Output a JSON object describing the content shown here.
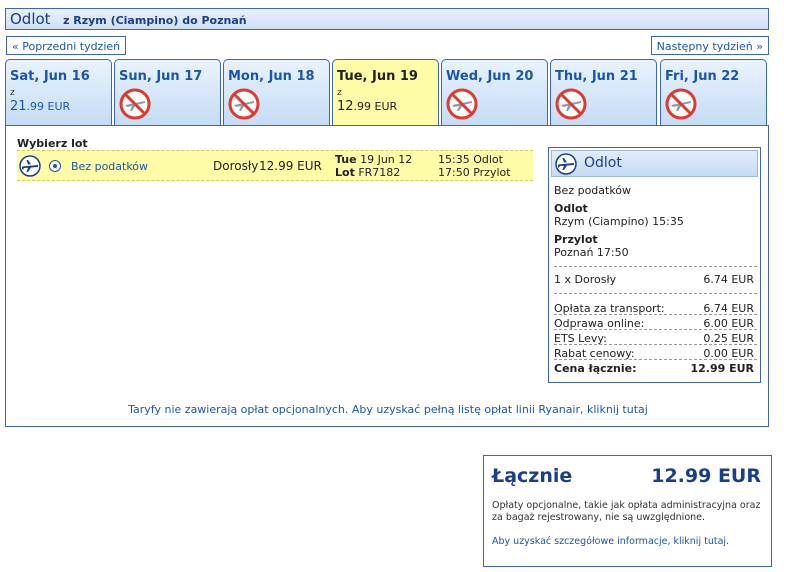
{
  "header": {
    "title": "Odlot",
    "route": "z Rzym (Ciampino) do Poznań"
  },
  "nav": {
    "prev_label": "« Poprzedni tydzień",
    "next_label": "Następny tydzień »"
  },
  "tabs": [
    {
      "date": "Sat, Jun 16",
      "z": "z",
      "price_big": "21",
      "price_small": ".99 EUR",
      "available": true
    },
    {
      "date": "Sun, Jun 17",
      "available": false
    },
    {
      "date": "Mon, Jun 18",
      "available": false
    },
    {
      "date": "Tue, Jun 19",
      "z": "z",
      "price_big": "12",
      "price_small": ".99 EUR",
      "available": true,
      "selected": true
    },
    {
      "date": "Wed, Jun 20",
      "available": false
    },
    {
      "date": "Thu, Jun 21",
      "available": false
    },
    {
      "date": "Fri, Jun 22",
      "available": false
    }
  ],
  "flight_list": {
    "heading": "Wybierz lot",
    "flight": {
      "fare_type": "Bez podatków",
      "passenger": "Dorosły",
      "price": "12.99 EUR",
      "day": "Tue",
      "date": "19 Jun 12",
      "lot_label": "Lot",
      "flight_no": "FR7182",
      "dep_time": "15:35",
      "dep_label": "Odlot",
      "arr_time": "17:50",
      "arr_label": "Przylot"
    }
  },
  "summary": {
    "title": "Odlot",
    "fare_type": "Bez podatków",
    "dep_heading": "Odlot",
    "dep_detail": "Rzym (Ciampino) 15:35",
    "arr_heading": "Przylot",
    "arr_detail": "Poznań 17:50",
    "pax_label": "1 x Dorosły",
    "pax_value": "6.74 EUR",
    "fees": [
      {
        "label": "Opłata za transport:",
        "value": "6.74 EUR"
      },
      {
        "label": "Odprawa online:",
        "value": "6.00 EUR"
      },
      {
        "label": "ETS Levy:",
        "value": "0.25 EUR"
      },
      {
        "label": "Rabat cenowy:",
        "value": "0.00 EUR"
      }
    ],
    "total_label": "Cena łącznie:",
    "total_value": "12.99 EUR"
  },
  "info_text": "Taryfy nie zawierają opłat opcjonalnych. Aby uzyskać pełną listę opłat linii Ryanair, kliknij tutaj",
  "total_box": {
    "label": "Łącznie",
    "value": "12.99 EUR",
    "note": "Opłaty opcjonalne, takie jak opłata administracyjna oraz za bagaż rejestrowany, nie są uwzględnione.",
    "link": "Aby uzyskać szczegółowe informacje, kliknij tutaj."
  },
  "colors": {
    "border": "#3f66b0",
    "selected_bg": "#fffca8",
    "link": "#1a56b0",
    "heading": "#1a3e8c"
  }
}
